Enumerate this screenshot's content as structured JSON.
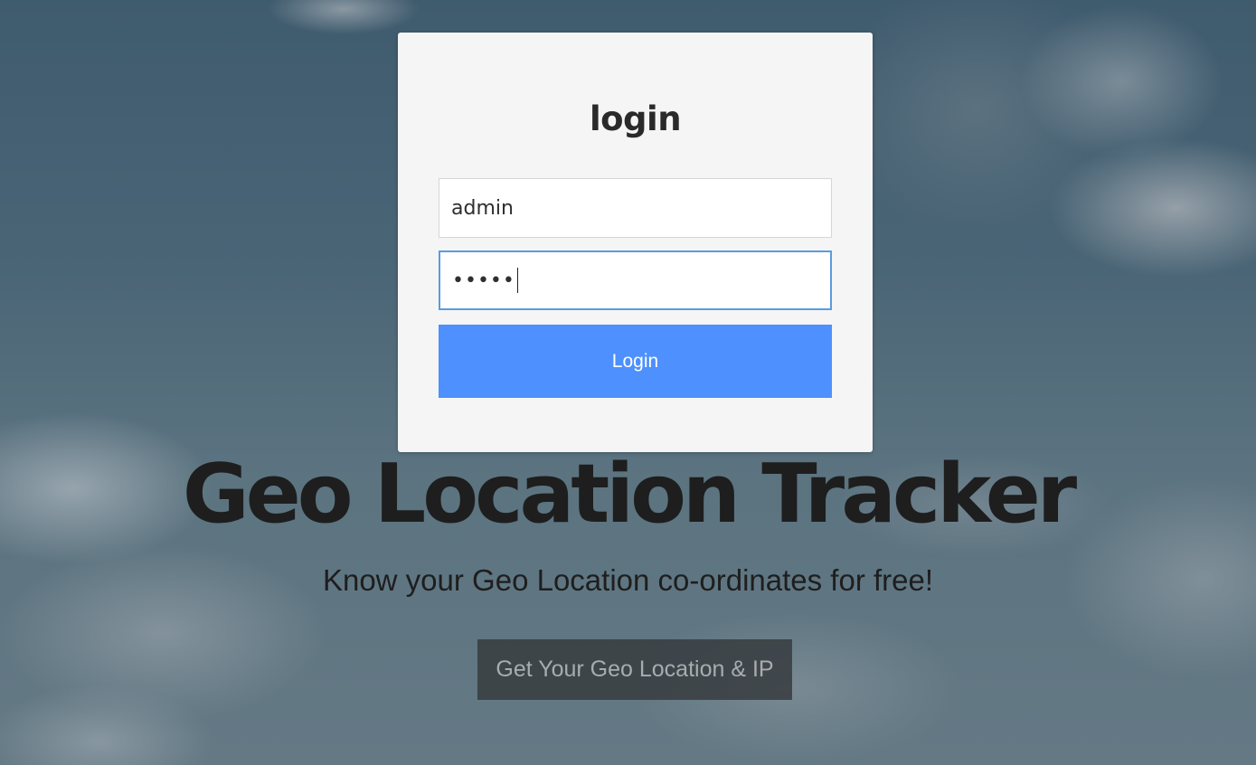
{
  "login": {
    "title": "login",
    "username_value": "admin",
    "password_mask": "•••••",
    "button_label": "Login"
  },
  "hero": {
    "title": "Geo Location Tracker",
    "subtitle": "Know your Geo Location co-ordinates for free!",
    "cta_label": "Get Your Geo Location & IP"
  },
  "colors": {
    "primary_button": "#4d90fe",
    "focus_border": "#5b9be0",
    "card_background": "#f5f5f5"
  }
}
